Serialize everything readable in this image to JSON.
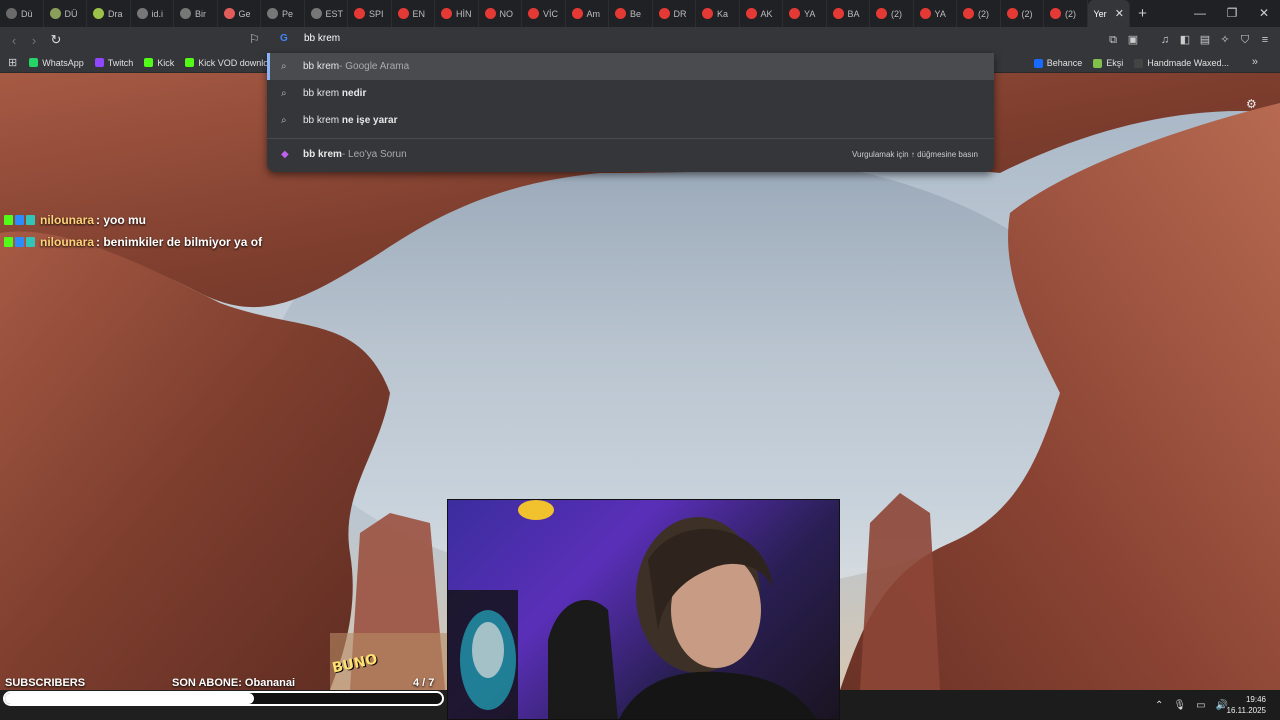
{
  "tabs": [
    {
      "label": "Dü",
      "color": "#6a6a6a"
    },
    {
      "label": "DÜ",
      "color": "#8aa05a"
    },
    {
      "label": "Dra",
      "color": "#9cc24a"
    },
    {
      "label": "id.i",
      "color": "#777"
    },
    {
      "label": "Bir",
      "color": "#777"
    },
    {
      "label": "Ge",
      "color": "#e25c5c"
    },
    {
      "label": "Pe",
      "color": "#777"
    },
    {
      "label": "EST",
      "color": "#777"
    },
    {
      "label": "SPI",
      "color": "#e53935"
    },
    {
      "label": "EN",
      "color": "#e53935"
    },
    {
      "label": "HİN",
      "color": "#e53935"
    },
    {
      "label": "NO",
      "color": "#e53935"
    },
    {
      "label": "VİC",
      "color": "#e53935"
    },
    {
      "label": "Am",
      "color": "#e53935"
    },
    {
      "label": "Be",
      "color": "#e53935"
    },
    {
      "label": "DR",
      "color": "#e53935"
    },
    {
      "label": "Ka",
      "color": "#e53935"
    },
    {
      "label": "AK",
      "color": "#e53935"
    },
    {
      "label": "YA",
      "color": "#e53935"
    },
    {
      "label": "BA",
      "color": "#e53935"
    },
    {
      "label": "(2)",
      "color": "#e53935"
    },
    {
      "label": "YA",
      "color": "#e53935"
    },
    {
      "label": "(2)",
      "color": "#e53935"
    },
    {
      "label": "(2)",
      "color": "#e53935"
    },
    {
      "label": "(2)",
      "color": "#e53935"
    }
  ],
  "active_tab": {
    "label": "Yer",
    "close": "✕"
  },
  "new_tab": "+",
  "window": {
    "minimize": "—",
    "restore": "❐",
    "close": "✕"
  },
  "omnibox": {
    "text": "bb krem"
  },
  "bookmarks": [
    {
      "label": "WhatsApp",
      "color": "#25d366"
    },
    {
      "label": "Twitch",
      "color": "#9146ff"
    },
    {
      "label": "Kick",
      "color": "#53fc18"
    },
    {
      "label": "Kick VOD downlo",
      "color": "#53fc18"
    }
  ],
  "bookmarks_right": [
    {
      "label": "Behance",
      "color": "#1769ff",
      "mark": "Bē"
    },
    {
      "label": "Ekşi",
      "color": "#81c14b",
      "mark": ""
    },
    {
      "label": "Handmade Waxed...",
      "color": "#444",
      "mark": ""
    }
  ],
  "suggestions": [
    {
      "bold": "bb krem",
      "rest": "",
      "dim": " - Google Arama"
    },
    {
      "bold": "",
      "plain": "bb krem ",
      "rest_bold": "nedir"
    },
    {
      "bold": "",
      "plain": "bb krem ",
      "rest_bold": "ne işe yarar"
    }
  ],
  "leo": {
    "bold": "bb krem",
    "dim": " - Leo'ya Sorun",
    "hint": "Vurgulamak için ↑ düğmesine basın"
  },
  "chat": [
    {
      "user": "nilounara",
      "message": ": yoo mu"
    },
    {
      "user": "nilounara",
      "message": ": benimkiler de bilmiyor ya of"
    }
  ],
  "overlay": {
    "subscribers_label": "SUBSCRIBERS",
    "son_abone": "SON ABONE: Obananai",
    "count": "4 / 7",
    "progress": 0.57,
    "sticker": "BUNO"
  },
  "clock": {
    "time": "19:46",
    "date": "16.11.2025"
  }
}
